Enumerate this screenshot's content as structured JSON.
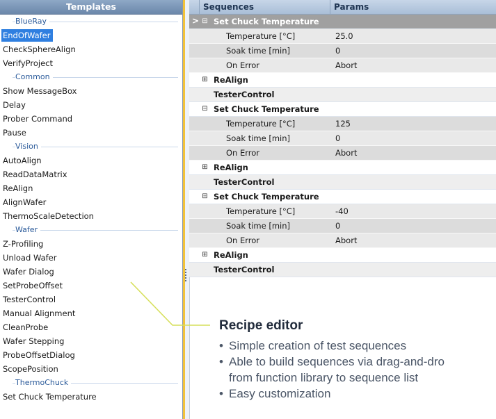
{
  "templates": {
    "header": "Templates",
    "entries": [
      {
        "kind": "group",
        "label": "BlueRay"
      },
      {
        "kind": "item",
        "label": "EndOfWafer",
        "selected": true
      },
      {
        "kind": "item",
        "label": "CheckSphereAlign"
      },
      {
        "kind": "item",
        "label": "VerifyProject"
      },
      {
        "kind": "group",
        "label": "Common"
      },
      {
        "kind": "item",
        "label": "Show MessageBox"
      },
      {
        "kind": "item",
        "label": "Delay"
      },
      {
        "kind": "item",
        "label": "Prober Command"
      },
      {
        "kind": "item",
        "label": "Pause"
      },
      {
        "kind": "group",
        "label": "Vision"
      },
      {
        "kind": "item",
        "label": "AutoAlign"
      },
      {
        "kind": "item",
        "label": "ReadDataMatrix"
      },
      {
        "kind": "item",
        "label": "ReAlign"
      },
      {
        "kind": "item",
        "label": "AlignWafer"
      },
      {
        "kind": "item",
        "label": "ThermoScaleDetection"
      },
      {
        "kind": "group",
        "label": "Wafer"
      },
      {
        "kind": "item",
        "label": "Z-Profiling"
      },
      {
        "kind": "item",
        "label": "Unload Wafer"
      },
      {
        "kind": "item",
        "label": "Wafer Dialog"
      },
      {
        "kind": "item",
        "label": "SetProbeOffset"
      },
      {
        "kind": "item",
        "label": "TesterControl"
      },
      {
        "kind": "item",
        "label": "Manual Alignment"
      },
      {
        "kind": "item",
        "label": "CleanProbe"
      },
      {
        "kind": "item",
        "label": "Wafer Stepping"
      },
      {
        "kind": "item",
        "label": "ProbeOffsetDialog"
      },
      {
        "kind": "item",
        "label": "ScopePosition"
      },
      {
        "kind": "group",
        "label": "ThermoChuck"
      },
      {
        "kind": "item",
        "label": "Set Chuck Temperature"
      }
    ]
  },
  "grid": {
    "col_sequences": "Sequences",
    "col_params": "Params",
    "current_indicator": ">",
    "rows": [
      {
        "type": "header",
        "label": "Set Chuck Temperature",
        "toggle": "⊟",
        "selected": true,
        "indicator": ">"
      },
      {
        "type": "param",
        "label": "Temperature [°C]",
        "value": "25.0"
      },
      {
        "type": "param",
        "label": "Soak time [min]",
        "value": "0"
      },
      {
        "type": "param",
        "label": "On Error",
        "value": "Abort"
      },
      {
        "type": "header",
        "label": "ReAlign",
        "toggle": "⊞"
      },
      {
        "type": "plain",
        "label": "TesterControl"
      },
      {
        "type": "header",
        "label": "Set Chuck Temperature",
        "toggle": "⊟"
      },
      {
        "type": "param",
        "label": "Temperature [°C]",
        "value": "125"
      },
      {
        "type": "param",
        "label": "Soak time [min]",
        "value": "0"
      },
      {
        "type": "param",
        "label": "On Error",
        "value": "Abort"
      },
      {
        "type": "header",
        "label": "ReAlign",
        "toggle": "⊞"
      },
      {
        "type": "plain",
        "label": "TesterControl"
      },
      {
        "type": "header",
        "label": "Set Chuck Temperature",
        "toggle": "⊟"
      },
      {
        "type": "param",
        "label": "Temperature [°C]",
        "value": "-40"
      },
      {
        "type": "param",
        "label": "Soak time [min]",
        "value": "0"
      },
      {
        "type": "param",
        "label": "On Error",
        "value": "Abort"
      },
      {
        "type": "header",
        "label": "ReAlign",
        "toggle": "⊞"
      },
      {
        "type": "plain",
        "label": "TesterControl"
      }
    ]
  },
  "callout": {
    "title": "Recipe editor",
    "bullets": [
      [
        "Simple creation of test sequences"
      ],
      [
        "Able to build sequences via drag-and-dro",
        "from function library to sequence list"
      ],
      [
        "Easy customization"
      ]
    ],
    "line_color": "#d6df5a"
  },
  "colors": {
    "selection": "#2f7fe0",
    "group_text": "#2a5a9a",
    "splitter_accent": "#f2c23a",
    "selected_row": "#a0a0a0"
  }
}
